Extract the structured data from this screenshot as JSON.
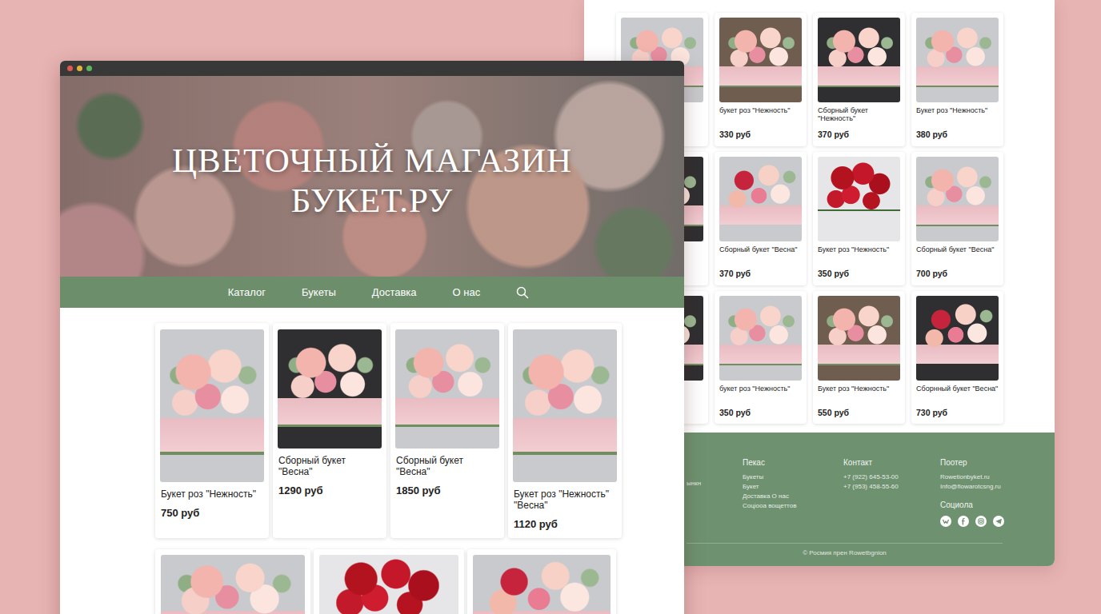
{
  "front_page": {
    "hero": {
      "title_lines": [
        "ЦВЕТОЧНЫЙ МАГАЗИН",
        "БУКЕТ.РУ"
      ]
    },
    "nav": [
      {
        "label": "Каталог"
      },
      {
        "label": "Букеты"
      },
      {
        "label": "Доставка"
      },
      {
        "label": "О нас"
      }
    ],
    "products": [
      {
        "name": "Букет роз \"Нежность\"",
        "price": "750 руб",
        "kind": "tall"
      },
      {
        "name": "Сборный букет \"Весна\"",
        "price": "1290 руб",
        "kind": "short"
      },
      {
        "name": "Сборный букет \"Весна\"",
        "price": "1850 руб",
        "kind": "short"
      },
      {
        "name": "Букет роз \"Нежность\" \"Весна\"",
        "price": "1120 руб",
        "kind": "tall"
      }
    ]
  },
  "back_page": {
    "product_rows": [
      [
        {
          "name": "букет роз \"Нежность\"",
          "price": "330 руб"
        },
        {
          "name": "Сборный букет \"Нежность\"",
          "price": "370 руб"
        },
        {
          "name": "Букет роз \"Нежность\"",
          "price": "380 руб"
        }
      ],
      [
        {
          "name": "Сборный букет \"Весна\"",
          "price": "370 руб"
        },
        {
          "name": "Букет роз \"Нежность\"",
          "price": "350 руб"
        },
        {
          "name": "Сборный букет \"Весна\"",
          "price": "700 руб"
        }
      ],
      [
        {
          "name": "букет роз \"Нежность\"",
          "price": "350 руб"
        },
        {
          "name": "Букет роз \"Нежность\"",
          "price": "550 руб"
        },
        {
          "name": "Сборнный букет \"Весна\"",
          "price": "730 руб"
        }
      ]
    ],
    "footer": {
      "fragment": "ынкн",
      "columns": [
        {
          "heading": "Пекас",
          "links": [
            "Букеты",
            "Букет",
            "Доставка О нас",
            "Соціооа вощеттов"
          ]
        },
        {
          "heading": "Контакт",
          "links": [
            "+7 (922) 645-53-00",
            "+7 (953) 458-55-60"
          ]
        },
        {
          "heading": "Поотер",
          "links": [
            "Rowetionbyket.ru",
            "Info@flowarotcsng.ru"
          ]
        }
      ],
      "social_heading": "Социола",
      "copyright": "© Росмия прен Rowetbgnion"
    }
  }
}
